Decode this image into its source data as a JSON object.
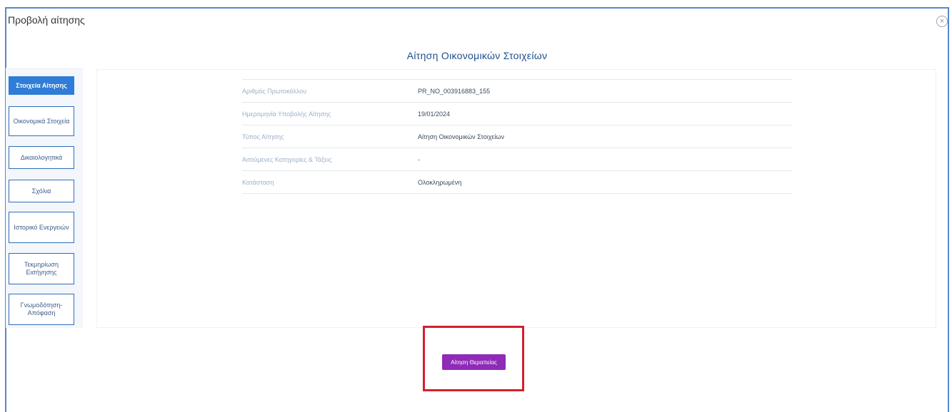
{
  "modal": {
    "title": "Προβολή αίτησης",
    "close_icon": "close-icon",
    "close_symbol": "×"
  },
  "page": {
    "heading": "Αίτηση Οικονομικών Στοιχείων"
  },
  "sidebar": {
    "items": [
      {
        "label": "Στοιχεία Αίτησης",
        "active": true
      },
      {
        "label": "Οικονομικά Στοιχεία",
        "active": false
      },
      {
        "label": "Δικαιολογητικά",
        "active": false
      },
      {
        "label": "Σχόλια",
        "active": false
      },
      {
        "label": "Ιστορικό Ενεργειών",
        "active": false
      },
      {
        "label": "Τεκμηρίωση Εισήγησης",
        "active": false
      },
      {
        "label": "Γνωμοδότηση-Απόφαση",
        "active": false
      }
    ]
  },
  "details": {
    "rows": [
      {
        "label": "Αριθμός Πρωτοκόλλου",
        "value": "PR_NO_003916883_155"
      },
      {
        "label": "Ημερομηνία Υποβολής Αίτησης",
        "value": "19/01/2024"
      },
      {
        "label": "Τύπος Αίτησης",
        "value": "Αίτηση Οικονομικών Στοιχείων"
      },
      {
        "label": "Αιτούμενες Κατηγορίες & Τάξεις",
        "value": "-"
      },
      {
        "label": "Κατάσταση",
        "value": "Ολοκληρωμένη"
      }
    ]
  },
  "actions": {
    "primary_label": "Αίτηση Θεραπείας"
  },
  "colors": {
    "accent": "#2f7dd6",
    "action": "#8e2bb8",
    "highlight": "#d0212e",
    "border": "#5b86c9"
  }
}
